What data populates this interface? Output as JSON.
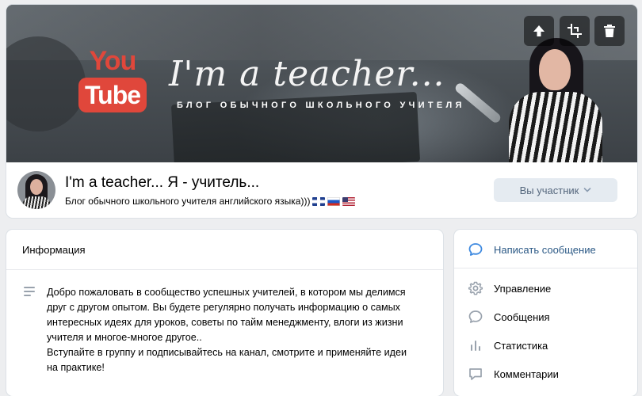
{
  "cover": {
    "logo_you": "You",
    "logo_tube": "Tube",
    "title": "I'm a teacher...",
    "subtitle": "БЛОГ ОБЫЧНОГО ШКОЛЬНОГО УЧИТЕЛЯ",
    "buttons": [
      {
        "icon": "upload-icon"
      },
      {
        "icon": "crop-icon"
      },
      {
        "icon": "trash-icon"
      }
    ]
  },
  "group": {
    "name": "I'm a teacher... Я - учитель...",
    "status": "Блог обычного школьного учителя английского языка)))",
    "status_flags": [
      "flag-uk-icon",
      "flag-ru-icon",
      "flag-us-icon"
    ],
    "member_button": "Вы участник"
  },
  "info": {
    "title": "Информация",
    "description_lines": [
      "Добро пожаловать в сообщество успешных учителей, в котором мы делимся",
      "друг с другом опытом. Вы будете регулярно получать информацию о самых",
      "интересных идеях для уроков, советы по тайм менеджменту, влоги из жизни",
      "учителя и многое-многое другое..",
      "Вступайте в группу и подписывайтесь на канал, смотрите и применяйте идеи",
      "на практике!"
    ]
  },
  "menu": {
    "write_message": "Написать сообщение",
    "manage": "Управление",
    "messages": "Сообщения",
    "statistics": "Статистика",
    "comments": "Комментарии"
  },
  "colors": {
    "accent": "#2a5885",
    "button_bg": "#e5ebf1",
    "page_bg": "#edeef0",
    "youtube_red": "#e0473b"
  }
}
